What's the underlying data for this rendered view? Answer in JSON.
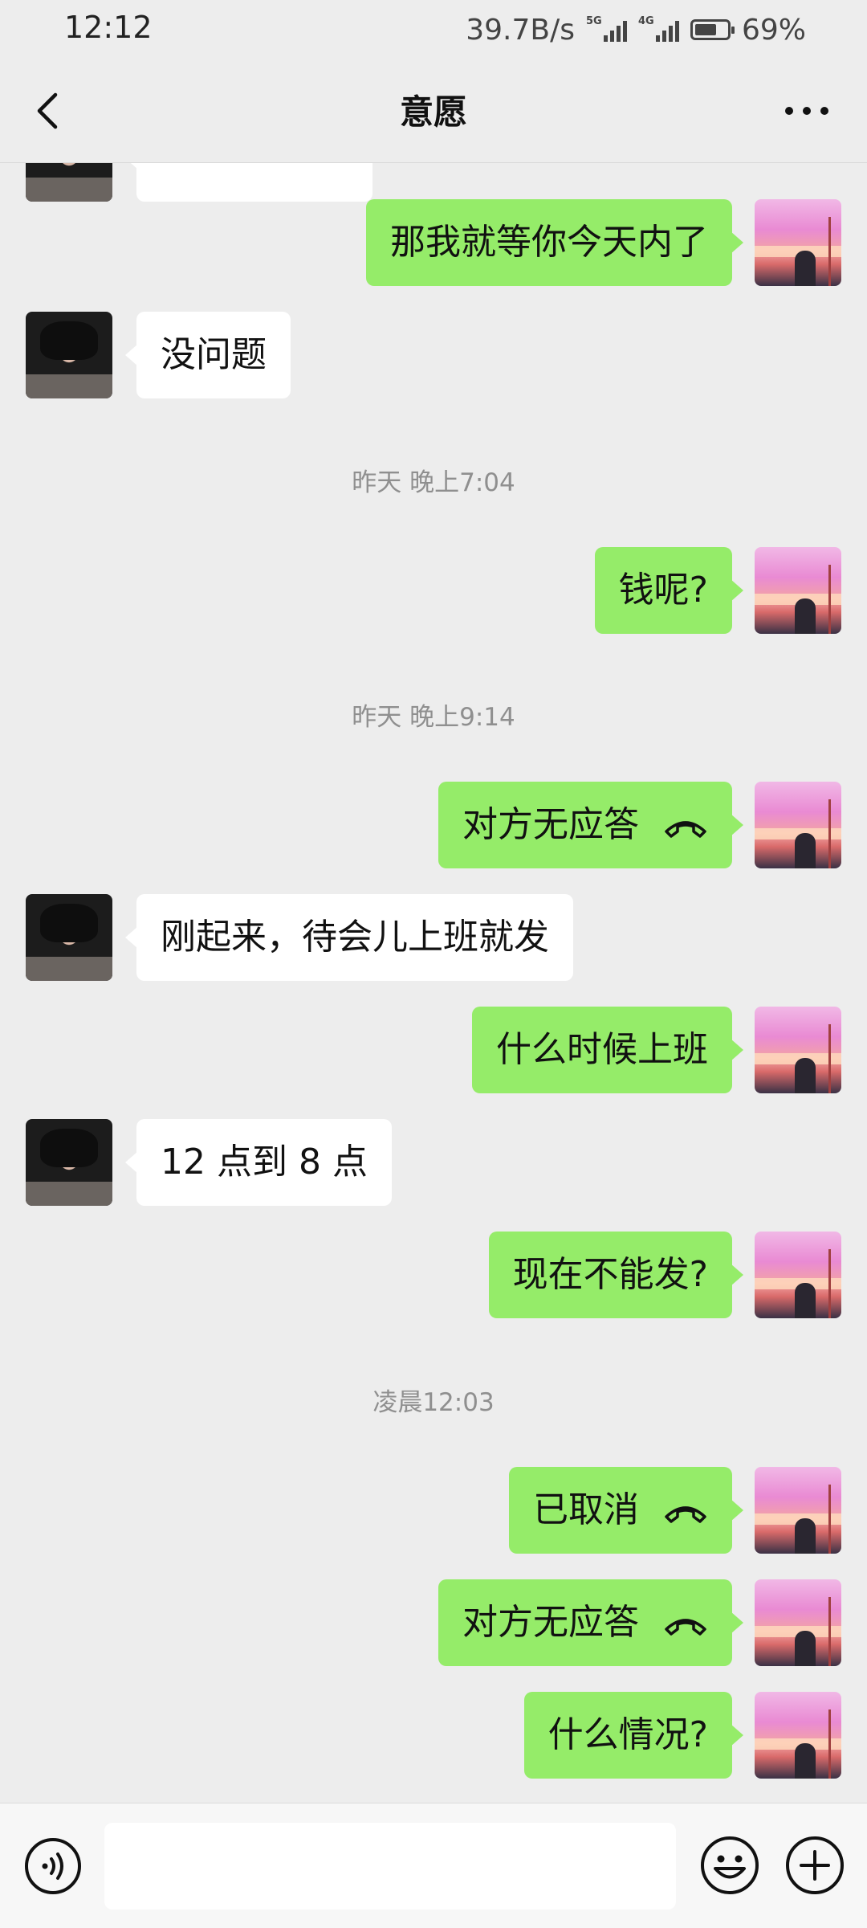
{
  "status": {
    "time": "12:12",
    "speed": "39.7B/s",
    "net1": "5G",
    "net2": "4G",
    "battery": "69%",
    "battery_level": 0.69
  },
  "header": {
    "title": "意愿"
  },
  "messages": [
    {
      "side": "right",
      "text": "那我就等你今天内了"
    },
    {
      "side": "left",
      "text": "没问题"
    },
    {
      "type": "time",
      "text": "昨天 晚上7:04"
    },
    {
      "side": "right",
      "text": "钱呢?"
    },
    {
      "type": "time",
      "text": "昨天 晚上9:14"
    },
    {
      "side": "right",
      "text": "对方无应答",
      "icon": "hangup-phone-icon"
    },
    {
      "side": "left",
      "text": "刚起来，待会儿上班就发"
    },
    {
      "side": "right",
      "text": "什么时候上班"
    },
    {
      "side": "left",
      "text": "12 点到 8 点"
    },
    {
      "side": "right",
      "text": "现在不能发?"
    },
    {
      "type": "time",
      "text": "凌晨12:03"
    },
    {
      "side": "right",
      "text": "已取消",
      "icon": "hangup-phone-icon"
    },
    {
      "side": "right",
      "text": "对方无应答",
      "icon": "hangup-phone-icon"
    },
    {
      "side": "right",
      "text": "什么情况?"
    }
  ],
  "input": {
    "placeholder": ""
  },
  "icons": {
    "back": "chevron-left-icon",
    "more": "more-dots-icon",
    "voice": "voice-icon",
    "emoji": "emoji-icon",
    "plus": "plus-icon"
  },
  "colors": {
    "sent_bubble": "#95ec69",
    "received_bubble": "#ffffff",
    "background": "#ededed"
  }
}
